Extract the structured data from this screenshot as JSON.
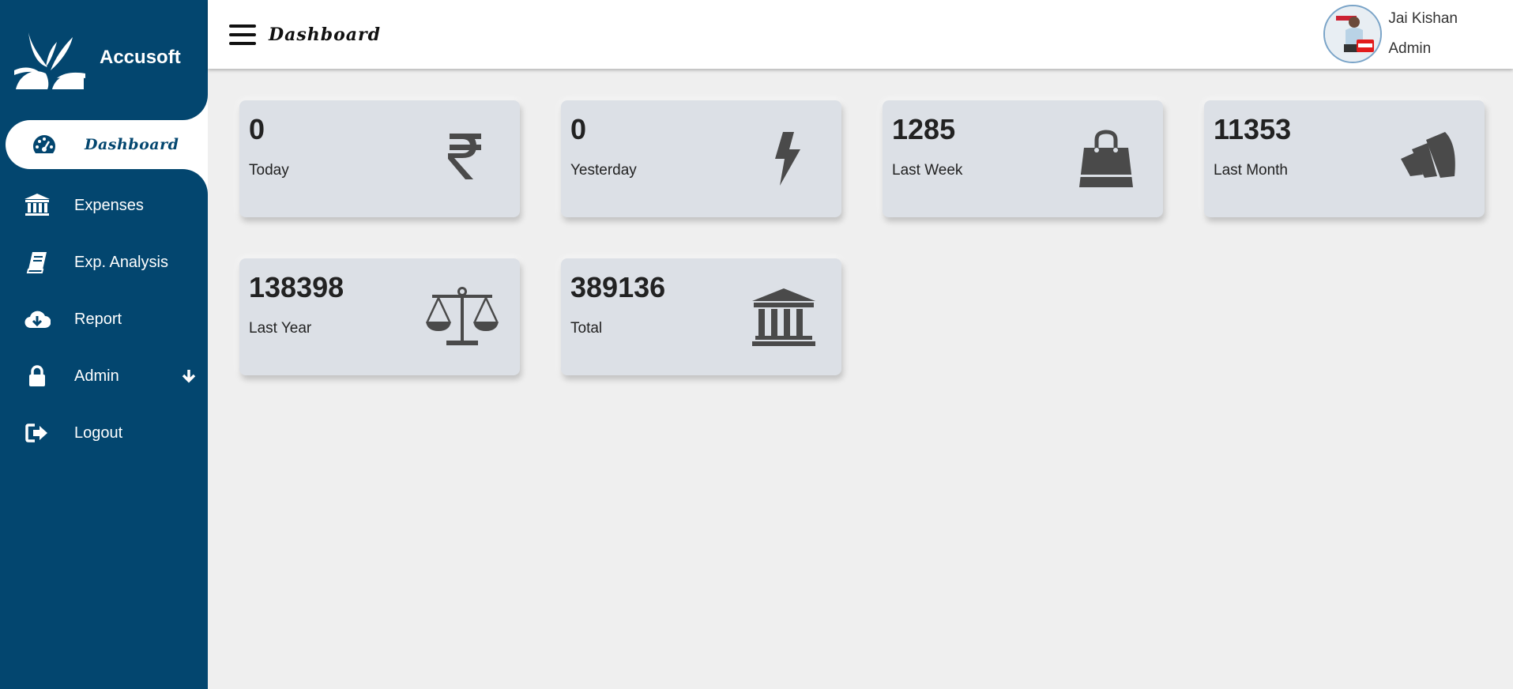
{
  "brand": {
    "name": "Accusoft"
  },
  "sidebar": {
    "items": [
      {
        "label": "Dashboard",
        "icon": "tachometer-icon",
        "active": true
      },
      {
        "label": "Expenses",
        "icon": "bank-icon"
      },
      {
        "label": "Exp. Analysis",
        "icon": "book-icon"
      },
      {
        "label": "Report",
        "icon": "cloud-download-icon"
      },
      {
        "label": "Admin",
        "icon": "lock-icon",
        "has_submenu": true
      },
      {
        "label": "Logout",
        "icon": "sign-out-icon"
      }
    ]
  },
  "header": {
    "title": "Dashboard",
    "user": {
      "name": "Jai Kishan",
      "role": "Admin"
    }
  },
  "cards": [
    {
      "value": "0",
      "label": "Today",
      "icon": "rupee-icon"
    },
    {
      "value": "0",
      "label": "Yesterday",
      "icon": "bolt-icon"
    },
    {
      "value": "1285",
      "label": "Last Week",
      "icon": "shopping-bag-icon"
    },
    {
      "value": "11353",
      "label": "Last Month",
      "icon": "bars-slanted-icon"
    },
    {
      "value": "138398",
      "label": "Last Year",
      "icon": "balance-scale-icon"
    },
    {
      "value": "389136",
      "label": "Total",
      "icon": "bank-icon"
    }
  ],
  "colors": {
    "sidebar": "#03466f",
    "card_bg": "#dce0e6",
    "icon": "#4a4a4a",
    "page_bg": "#efefef"
  }
}
